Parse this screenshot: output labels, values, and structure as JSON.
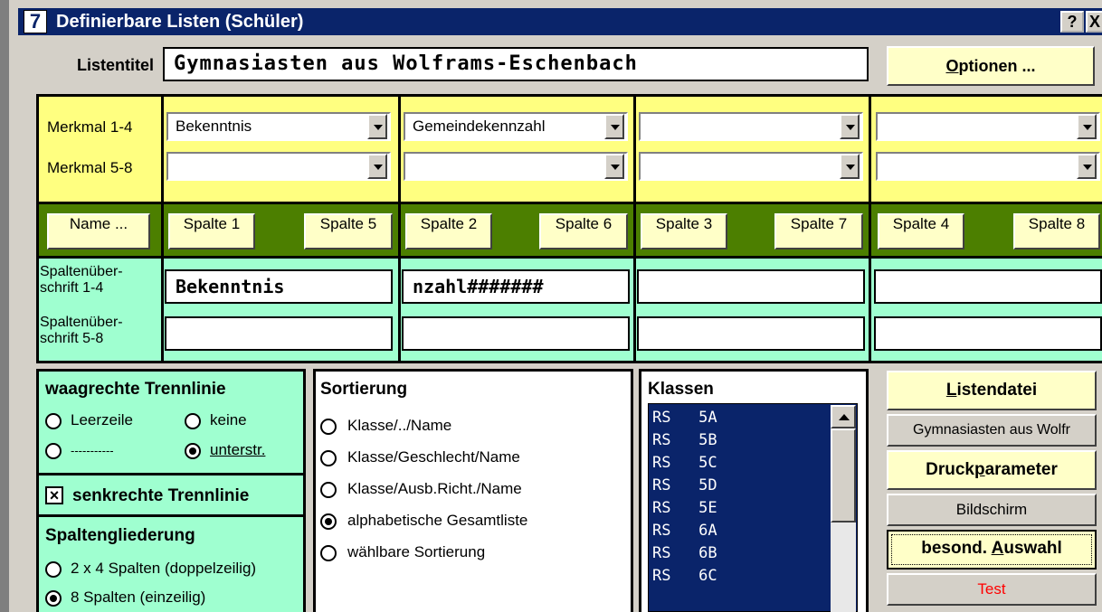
{
  "window": {
    "icon_text": "7",
    "title": "Definierbare Listen (Schüler)",
    "help_button": "?",
    "close_button": "X"
  },
  "listentitel": {
    "label": "Listentitel",
    "value": "Gymnasiasten aus Wolframs-Eschenbach"
  },
  "optionen_button": {
    "hotkey": "O",
    "rest": "ptionen ..."
  },
  "merkmal": {
    "label_1_4": "Merkmal 1-4",
    "label_5_8": "Merkmal 5-8",
    "row1": [
      "Bekenntnis",
      "Gemeindekennzahl",
      "",
      ""
    ],
    "row2": [
      "",
      "",
      "",
      ""
    ]
  },
  "spalten_buttons": {
    "name": "Name ...",
    "groups": [
      {
        "left": "Spalte 1",
        "right": "Spalte 5"
      },
      {
        "left": "Spalte 2",
        "right": "Spalte 6"
      },
      {
        "left": "Spalte 3",
        "right": "Spalte 7"
      },
      {
        "left": "Spalte 4",
        "right": "Spalte 8"
      }
    ]
  },
  "spaltenueberschrift": {
    "label_1_4_line1": "Spaltenüber-",
    "label_1_4_line2": "schrift 1-4",
    "label_5_8_line1": "Spaltenüber-",
    "label_5_8_line2": "schrift 5-8",
    "row1": [
      "Bekenntnis",
      "nzahl#######",
      "",
      ""
    ],
    "row2": [
      "",
      "",
      "",
      ""
    ]
  },
  "trennlinie": {
    "title": "waagrechte Trennlinie",
    "options": {
      "leerzeile": "Leerzeile",
      "keine": "keine",
      "dashes": "-----------",
      "unterstr": "unterstr."
    },
    "selected": "unterstr."
  },
  "senkrechte": {
    "label": "senkrechte Trennlinie",
    "checked": true,
    "mark": "×"
  },
  "spaltengliederung": {
    "title": "Spaltengliederung",
    "options": [
      "2 x 4 Spalten (doppelzeilig)",
      "8 Spalten (einzeilig)"
    ],
    "selected": "8 Spalten (einzeilig)"
  },
  "sortierung": {
    "title": "Sortierung",
    "options": [
      "Klasse/../Name",
      "Klasse/Geschlecht/Name",
      "Klasse/Ausb.Richt./Name",
      "alphabetische Gesamtliste",
      "wählbare Sortierung"
    ],
    "selected": "alphabetische Gesamtliste"
  },
  "klassen": {
    "title": "Klassen",
    "items": [
      "RS   5A",
      "RS   5B",
      "RS   5C",
      "RS   5D",
      "RS   5E",
      "RS   6A",
      "RS   6B",
      "RS   6C"
    ]
  },
  "right_panel": {
    "listendatei": {
      "hotkey": "L",
      "rest": "istendatei"
    },
    "listendatei_value": "Gymnasiasten aus Wolfr",
    "druckparameter": {
      "pre": "Druck",
      "hotkey": "p",
      "rest": "arameter"
    },
    "bildschirm": "Bildschirm",
    "auswahl": {
      "pre": "besond. ",
      "hotkey": "A",
      "rest": "uswahl"
    },
    "test": "Test",
    "colors": {
      "test_text": "#ff0000"
    }
  }
}
